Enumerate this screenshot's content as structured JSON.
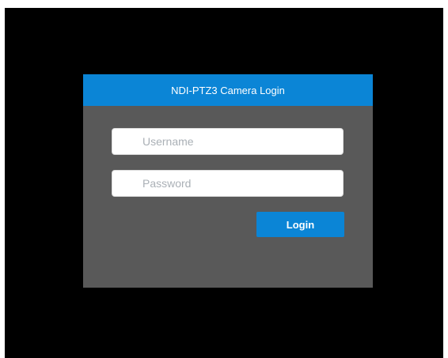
{
  "login": {
    "title": "NDI-PTZ3 Camera Login",
    "username": {
      "value": "",
      "placeholder": "Username"
    },
    "password": {
      "value": "",
      "placeholder": "Password"
    },
    "login_label": "Login"
  },
  "colors": {
    "page_background": "#ffffff",
    "screen_background": "#000000",
    "panel_background": "#595959",
    "accent": "#0b85d6",
    "input_background": "#ffffff",
    "placeholder_text": "#aab0b6",
    "button_text": "#ffffff"
  }
}
